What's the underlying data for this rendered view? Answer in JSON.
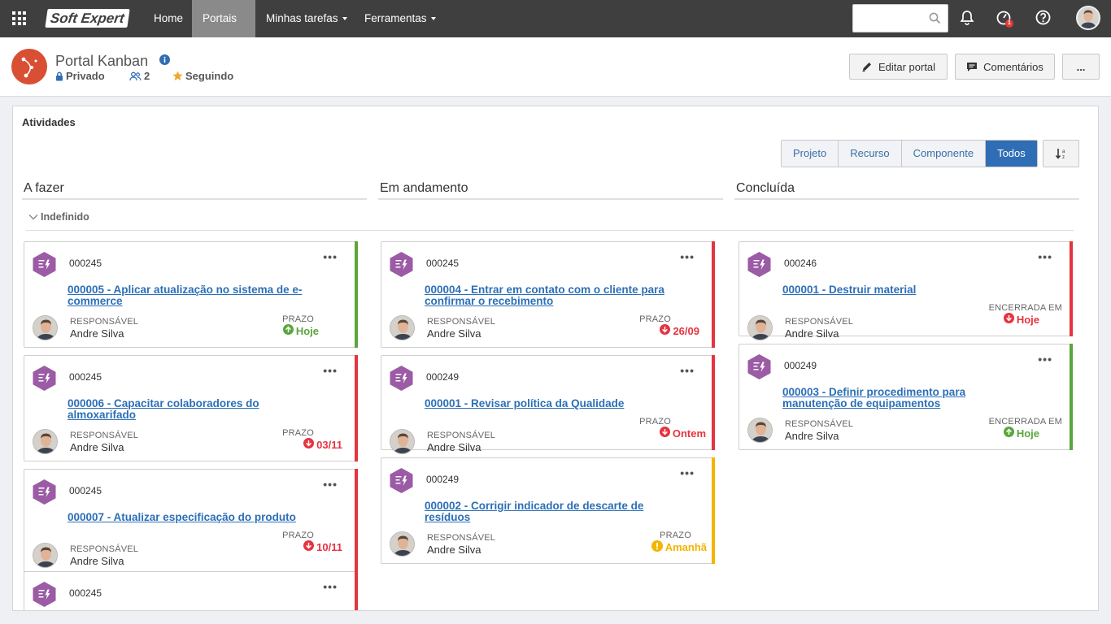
{
  "topbar": {
    "logo": "Soft Expert",
    "nav": [
      {
        "label": "Home"
      },
      {
        "label": "Portais"
      },
      {
        "label": "Minhas tarefas"
      },
      {
        "label": "Ferramentas"
      }
    ],
    "search_placeholder": "",
    "notification_badge": "1"
  },
  "header": {
    "title": "Portal Kanban",
    "privacy": "Privado",
    "members": "2",
    "following": "Seguindo",
    "edit_label": "Editar portal",
    "comments_label": "Comentários",
    "more_label": "..."
  },
  "panel": {
    "title": "Atividades",
    "filters": [
      "Projeto",
      "Recurso",
      "Componente",
      "Todos"
    ],
    "active_filter": "Todos",
    "group": "Indefinido",
    "columns": [
      {
        "title": "A fazer"
      },
      {
        "title": "Em andamento"
      },
      {
        "title": "Concluída"
      }
    ]
  },
  "colors": {
    "green": "#5aa63a",
    "red": "#e53340",
    "yellow": "#f4b400",
    "accent": "#2f6eb4",
    "hex": "#9b5ba5"
  },
  "cards": [
    {
      "code": "000245",
      "title": "000005 - Aplicar atualização no sistema de e-commerce",
      "resp_label": "RESPONSÁVEL",
      "resp_name": "Andre Silva",
      "deadline_label": "PRAZO",
      "deadline": "Hoje",
      "status": "green",
      "icon": "arrow-up-circle-icon"
    },
    {
      "code": "000245",
      "title": "000006 - Capacitar colaboradores do almoxarifado",
      "resp_label": "RESPONSÁVEL",
      "resp_name": "Andre Silva",
      "deadline_label": "PRAZO",
      "deadline": "03/11",
      "status": "red",
      "icon": "arrow-down-circle-icon"
    },
    {
      "code": "000245",
      "title": "000007 - Atualizar especificação do produto",
      "resp_label": "RESPONSÁVEL",
      "resp_name": "Andre Silva",
      "deadline_label": "PRAZO",
      "deadline": "10/11",
      "status": "red",
      "icon": "arrow-down-circle-icon"
    },
    {
      "code": "000245",
      "status": "red"
    },
    {
      "code": "000245",
      "title": "000004 - Entrar em contato com o cliente para confirmar o recebimento",
      "resp_label": "RESPONSÁVEL",
      "resp_name": "Andre Silva",
      "deadline_label": "PRAZO",
      "deadline": "26/09",
      "status": "red",
      "icon": "arrow-down-circle-icon"
    },
    {
      "code": "000249",
      "title": "000001 - Revisar política da Qualidade",
      "resp_label": "RESPONSÁVEL",
      "resp_name": "Andre Silva",
      "deadline_label": "PRAZO",
      "deadline": "Ontem",
      "status": "red",
      "icon": "arrow-down-circle-icon"
    },
    {
      "code": "000249",
      "title": "000002 - Corrigir indicador de descarte de resíduos",
      "resp_label": "RESPONSÁVEL",
      "resp_name": "Andre Silva",
      "deadline_label": "PRAZO",
      "deadline": "Amanhã",
      "status": "yellow",
      "icon": "warning-circle-icon"
    },
    {
      "code": "000246",
      "title": "000001 - Destruir material",
      "resp_label": "RESPONSÁVEL",
      "resp_name": "Andre Silva",
      "deadline_label": "ENCERRADA EM",
      "deadline": "Hoje",
      "status": "red",
      "icon": "arrow-down-circle-icon"
    },
    {
      "code": "000249",
      "title": "000003 - Definir procedimento para manutenção de equipamentos",
      "resp_label": "RESPONSÁVEL",
      "resp_name": "Andre Silva",
      "deadline_label": "ENCERRADA EM",
      "deadline": "Hoje",
      "status": "green",
      "icon": "arrow-up-circle-icon"
    }
  ]
}
